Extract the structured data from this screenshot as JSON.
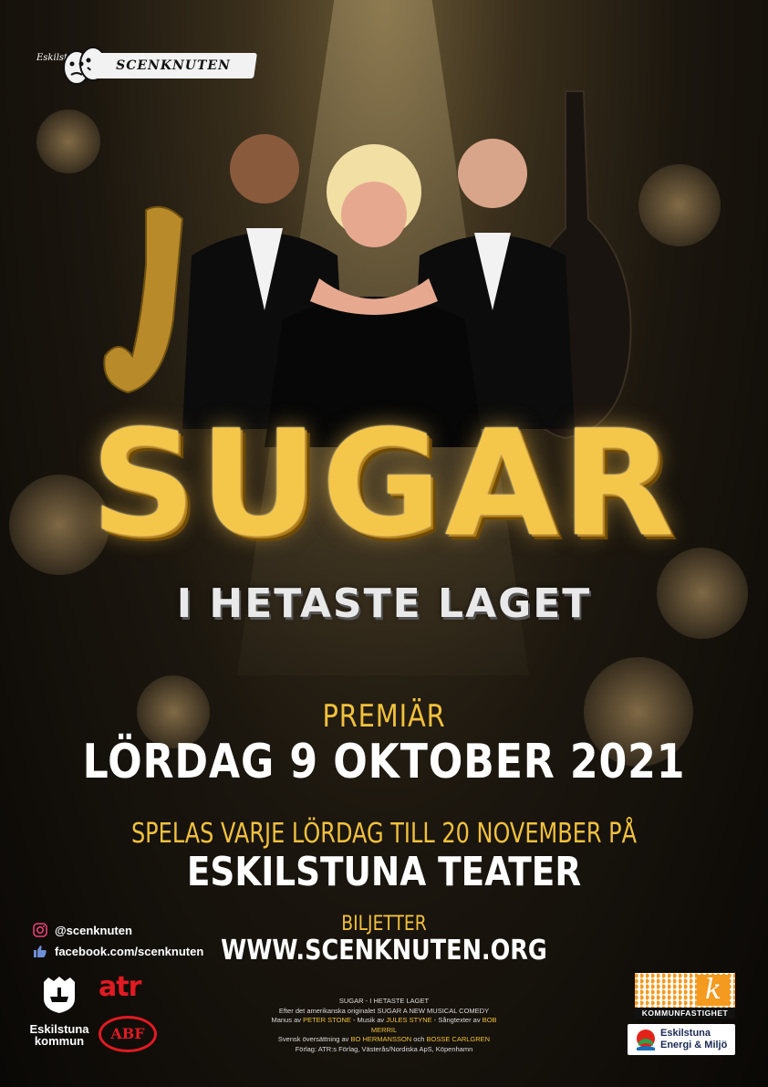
{
  "logo": {
    "city": "Eskilstuna",
    "name": "SCENKNUTEN"
  },
  "title": "SUGAR",
  "subtitle": "I HETASTE LAGET",
  "premiere_label": "PREMIÄR",
  "premiere_date": "LÖRDAG 9 OKTOBER 2021",
  "schedule": "SPELAS VARJE LÖRDAG TILL 20 NOVEMBER PÅ",
  "venue": "ESKILSTUNA TEATER",
  "tickets_label": "BILJETTER",
  "tickets_url": "WWW.SCENKNUTEN.ORG",
  "social": {
    "instagram": "@scenknuten",
    "facebook": "facebook.com/scenknuten"
  },
  "credits": {
    "line1": "SUGAR - I HETASTE LAGET",
    "line2": "Efter det amerikanska originalet SUGAR A NEW MUSICAL COMEDY",
    "line3_pre": "Manus av ",
    "line3_a": "PETER STONE",
    "line3_mid": " - Musik av ",
    "line3_b": "JULES STYNE",
    "line3_mid2": " - Sångtexter av ",
    "line3_c": "BOB MERRIL",
    "line4_pre": "Svensk översättning av ",
    "line4_a": "BO HERMANSSON",
    "line4_mid": " och ",
    "line4_b": "BOSSE CARLGREN",
    "line5": "Förlag: ATR:s Förlag, Västerås/Nordiska ApS, Köpenhamn"
  },
  "sponsors": {
    "kommun": "Eskilstuna kommun",
    "atr": "atr",
    "abf": "ABF",
    "kommunfastighet_k": "k",
    "kommunfastighet": "KOMMUNFASTIGHET",
    "eem_line1": "Eskilstuna",
    "eem_line2": "Energi & Miljö"
  },
  "colors": {
    "gold": "#f1c13c",
    "red": "#e11a22",
    "orange": "#f39a1f",
    "background": "#0b0906"
  },
  "icons": [
    "instagram-icon",
    "thumbs-up-icon",
    "theater-masks-icon",
    "coat-of-arms-icon"
  ]
}
